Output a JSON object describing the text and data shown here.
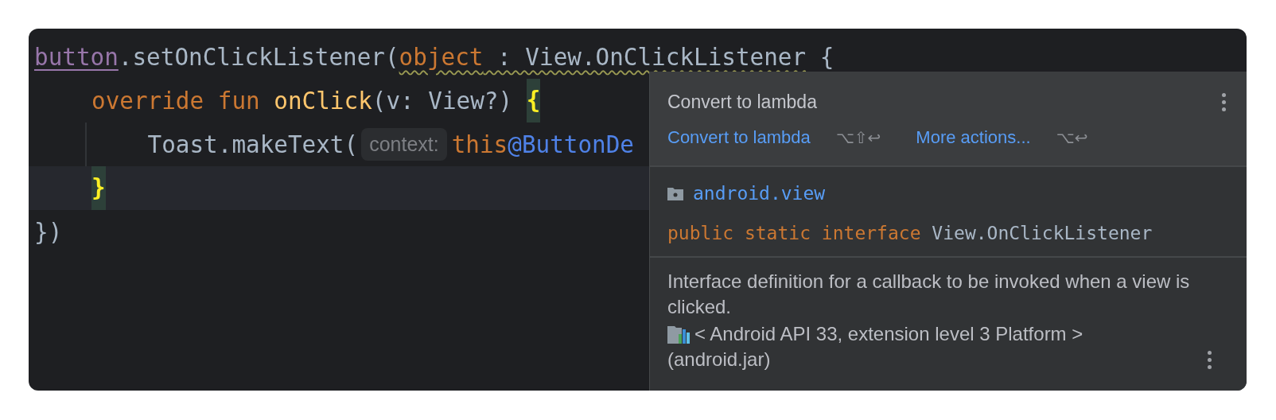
{
  "editor": {
    "lines": [
      {
        "current": false,
        "indent": false,
        "inner": false,
        "tokens": [
          {
            "kind": "property",
            "text": "button"
          },
          {
            "kind": "plain",
            "text": ".setOnClickListener("
          },
          {
            "kind": "keyword",
            "text": "object",
            "warning": true
          },
          {
            "kind": "plain",
            "text": " : View.OnClickListener",
            "warning": true
          },
          {
            "kind": "plain",
            "text": " {"
          }
        ]
      },
      {
        "current": false,
        "indent": false,
        "inner": true,
        "tokens": [
          {
            "kind": "keyword",
            "text": "override fun "
          },
          {
            "kind": "function",
            "text": "onClick"
          },
          {
            "kind": "plain",
            "text": "(v: View?) "
          },
          {
            "kind": "brace-match",
            "text": "{"
          }
        ]
      },
      {
        "current": false,
        "indent": true,
        "inner": true,
        "tokens": [
          {
            "kind": "plain",
            "text": "    Toast.makeText("
          },
          {
            "kind": "hint",
            "text": "context:"
          },
          {
            "kind": "keyword",
            "text": "this"
          },
          {
            "kind": "label",
            "text": "@ButtonDe"
          }
        ]
      },
      {
        "current": true,
        "indent": false,
        "inner": true,
        "tokens": [
          {
            "kind": "brace-match",
            "text": "}"
          }
        ]
      },
      {
        "current": false,
        "indent": false,
        "inner": false,
        "tokens": [
          {
            "kind": "plain",
            "text": "})"
          }
        ]
      }
    ]
  },
  "popup": {
    "title": "Convert to lambda",
    "actions": [
      {
        "label": "Convert to lambda",
        "shortcut": "⌥⇧↩"
      },
      {
        "label": "More actions...",
        "shortcut": "⌥↩"
      }
    ],
    "package": "android.view",
    "declaration": [
      {
        "kind": "keyword",
        "text": "public static interface "
      },
      {
        "kind": "plain",
        "text": "View.OnClickListener"
      }
    ],
    "description": "Interface definition for a callback to be invoked when a view is clicked.",
    "library": "< Android API 33, extension level 3 Platform >",
    "jar": "(android.jar)"
  }
}
